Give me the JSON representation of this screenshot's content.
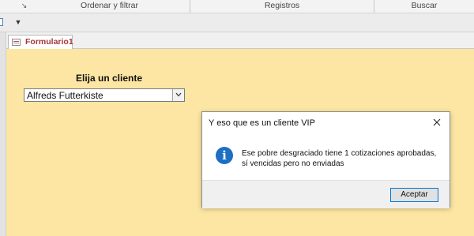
{
  "ribbon": {
    "groups": [
      "Ordenar y filtrar",
      "Registros",
      "Buscar"
    ]
  },
  "tab": {
    "label": "Formulario1"
  },
  "form": {
    "heading": "Elija un cliente",
    "combo_value": "Alfreds Futterkiste",
    "background": "#fde6a3"
  },
  "dialog": {
    "title": "Y eso que es un cliente VIP",
    "message": "Ese pobre desgraciado tiene 1 cotizaciones aprobadas, sí vencidas pero no enviadas",
    "ok_label": "Aceptar"
  },
  "icons": {
    "launcher": "dialog-launcher-icon",
    "qa_dropdown": "customize-quick-access-icon",
    "form": "form-icon",
    "combo_arrow": "chevron-down-icon",
    "close": "close-icon",
    "info": "info-icon"
  }
}
